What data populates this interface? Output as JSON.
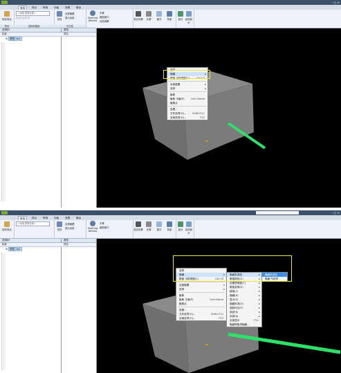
{
  "colors": {
    "accent": "#f1e33a",
    "highlight": "#3d8ee8",
    "axis_green": "#2ee06a",
    "box": "#7b7b7b",
    "ribbon": "#eef2f8"
  },
  "top": {
    "tabs": [
      "常用",
      "视点",
      "审阅",
      "动画",
      "查看",
      "输出"
    ],
    "ribbon": {
      "search_placeholder": "<设置 模型标准>",
      "groups": [
        "项目",
        "选择和搜索",
        "可见性",
        "显示",
        "工具"
      ],
      "buttons": [
        "保存视点",
        "查找",
        "Steering Wheels",
        "平移",
        "缩放窗口",
        "动态观察",
        "真实效果",
        "光源",
        "模式",
        "背景",
        "剖分",
        "启用剖分"
      ],
      "rows": [
        "全部隐藏",
        "显示全部",
        "显示隐藏项目"
      ]
    },
    "left_panel": {
      "title": "选择树",
      "tab": "标准",
      "item": "模型.nwc"
    },
    "mid_panel": {
      "title": "属性",
      "tab": "项目"
    },
    "context_menu": [
      {
        "label": "选择"
      },
      {
        "label": "隐藏",
        "arrow": "▸",
        "highlight": true
      },
      {
        "label": "覆盖 当前视图(C)",
        "shortcut": "Ctrl+Z"
      },
      {
        "label": "全部重置",
        "arrow": "▸"
      },
      {
        "label": "选择",
        "arrow": "▸"
      },
      {
        "label": "聚焦"
      },
      {
        "label": "聚焦 平面(P)",
        "shortcut": "Ctrl+Home"
      },
      {
        "label": "聚焦点"
      },
      {
        "label": "查看..."
      },
      {
        "label": "文件选项(O)...",
        "shortcut": "Shift+F11"
      },
      {
        "label": "全局选项(O)...",
        "shortcut": "F12"
      }
    ]
  },
  "bottom": {
    "tabs": [
      "常用",
      "视点",
      "审阅",
      "动画",
      "查看",
      "输出"
    ],
    "left_panel": {
      "title": "选择树",
      "tab": "标准",
      "item": "模型.nwc"
    },
    "mid_panel": {
      "title": "属性",
      "tab": "项目"
    },
    "context_menu": [
      {
        "label": "选择"
      },
      {
        "label": "隐藏",
        "arrow": "▸",
        "highlight": true
      },
      {
        "label": "覆盖 当前视图(C)",
        "shortcut": "Ctrl+Z"
      },
      {
        "label": "全部重置",
        "arrow": "▸"
      },
      {
        "label": "选择",
        "arrow": "▸"
      },
      {
        "label": "聚焦"
      },
      {
        "label": "聚焦 平面(P)",
        "shortcut": "Ctrl+Home"
      },
      {
        "label": "聚焦点"
      },
      {
        "label": "查看..."
      },
      {
        "label": "文件选项(O)...",
        "shortcut": "Shift+F11"
      },
      {
        "label": "全局选项(O)...",
        "shortcut": "F12"
      }
    ],
    "submenu1": [
      {
        "label": "隐藏未选定",
        "arrow": "▸",
        "highlight": true
      },
      {
        "label": "覆盖颜色(C)",
        "arrow": "▸"
      },
      {
        "label": "设置透明度(T)",
        "arrow": "▸"
      },
      {
        "label": "覆盖变换(Z)",
        "arrow": "▸"
      },
      {
        "label": "链接(L)",
        "arrow": "▸"
      },
      {
        "label": "隐藏(H)",
        "arrow": "▸"
      },
      {
        "label": "显示(S)",
        "arrow": "▸"
      },
      {
        "label": "隐藏未选(U)",
        "arrow": "▸"
      },
      {
        "label": "强制可见(F)",
        "arrow": "▸"
      },
      {
        "label": "锁定(K)",
        "arrow": "▸"
      },
      {
        "label": "全部(A)",
        "arrow": "▸"
      },
      {
        "label": "全部显示",
        "shortcut": "F11"
      },
      {
        "label": "隐藏和取消隐藏..."
      }
    ],
    "submenu2": [
      {
        "label": "隐藏未选定"
      },
      {
        "label": "隐藏 所选项"
      }
    ]
  }
}
